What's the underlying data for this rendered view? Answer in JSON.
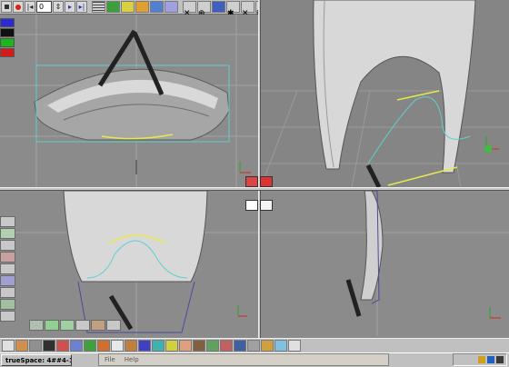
{
  "app": {
    "task_label": "trueSpace: 4##4-1",
    "frame_value": "0"
  },
  "menu": {
    "items": [
      "File",
      "Help"
    ]
  },
  "colors": {
    "background": "#8b8b8b",
    "grid": "#a0a0a0",
    "wire": "#5ecfcf",
    "curve": "#e8e84a",
    "model": "#d6d6d6",
    "taskbar": "#c0c0c0"
  },
  "toolbar_top": {
    "icons": [
      "stop-icon",
      "record-icon",
      "rewind-icon",
      "prev-frame-icon",
      "next-frame-icon",
      "forward-icon",
      "list-icon",
      "object-nav-icon",
      "eye-icon",
      "spline-icon",
      "pan-icon",
      "rotate-icon",
      "scale-icon",
      "move-icon",
      "render-icon",
      "light-icon",
      "camera-icon",
      "wire-icon",
      "view-icon"
    ]
  },
  "toolbar_bottom": {
    "icons": [
      "sphere-icon",
      "cube-icon",
      "torus-icon",
      "cylinder-icon",
      "cone-icon",
      "plane-icon",
      "text-icon",
      "material-icon",
      "paint-icon",
      "gear-icon",
      "checker-icon",
      "light-icon",
      "spot-icon",
      "face-icon",
      "figure-icon",
      "render-icon"
    ]
  },
  "left_palette": {
    "swatches": [
      "#2b2bd4",
      "#101010",
      "#1bb81b",
      "#d41b1b",
      "#dcdcdc"
    ]
  }
}
